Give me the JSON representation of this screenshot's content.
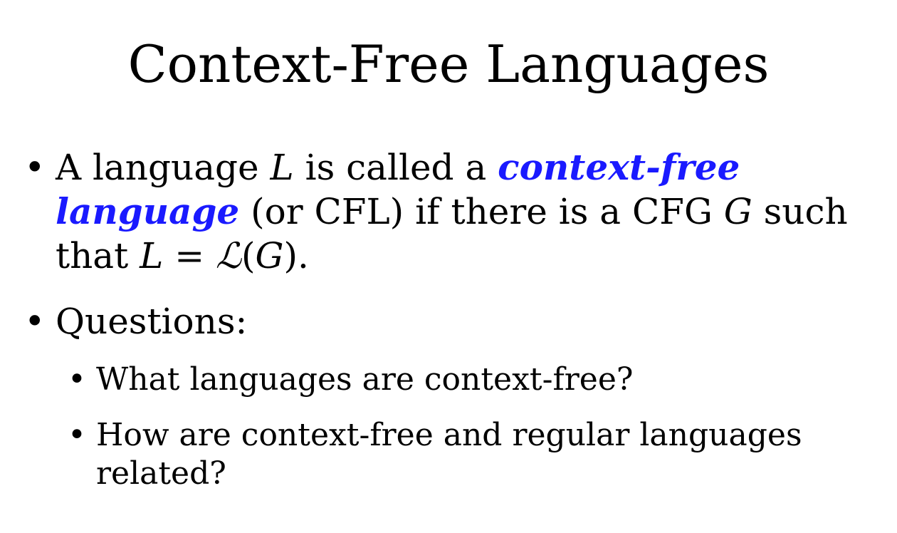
{
  "slide": {
    "title": "Context-Free Languages",
    "bullet1": {
      "marker": "•",
      "text_a": "A language ",
      "var_L": "L",
      "text_b": " is called a ",
      "term": "context-free language",
      "text_c": " (or CFL) if there is a CFG ",
      "var_G": "G",
      "text_d": " such that ",
      "var_L2": "L",
      "text_e": " = ",
      "script_L": "ℒ",
      "paren_open": "(",
      "var_G2": "G",
      "text_f": ")."
    },
    "bullet2": {
      "marker": "•",
      "text": "Questions:"
    },
    "sub_bullets": [
      {
        "marker": "•",
        "text": "What languages are context-free?"
      },
      {
        "marker": "•",
        "text": "How are context-free and regular languages related?"
      }
    ],
    "colors": {
      "term": "#1a1aff",
      "text": "#000000",
      "background": "#ffffff"
    }
  }
}
